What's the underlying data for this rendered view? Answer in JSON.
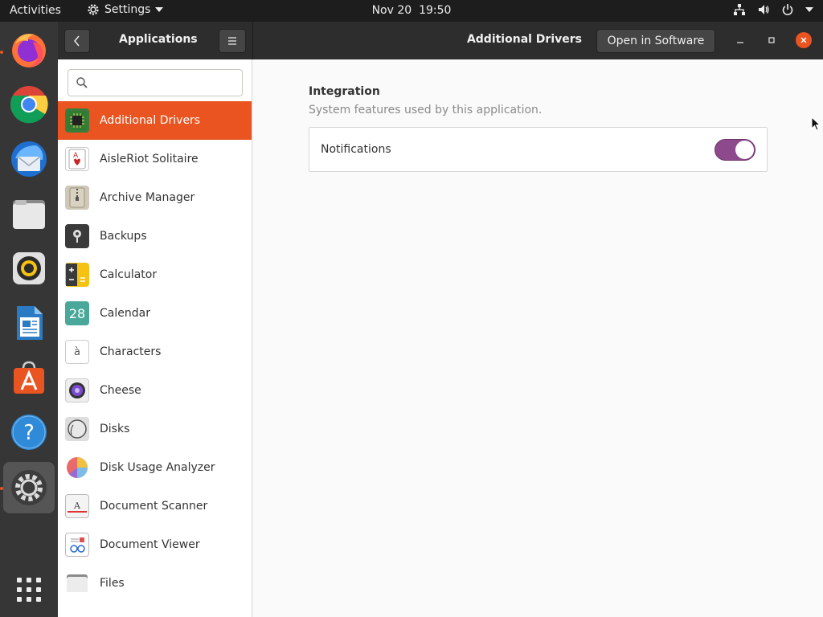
{
  "topbar": {
    "activities": "Activities",
    "app_menu": "Settings",
    "date": "Nov 20",
    "time": "19:50"
  },
  "dock": {
    "items": [
      {
        "name": "firefox",
        "running": true
      },
      {
        "name": "chrome",
        "running": false
      },
      {
        "name": "thunderbird",
        "running": false
      },
      {
        "name": "files",
        "running": false
      },
      {
        "name": "rhythmbox",
        "running": false
      },
      {
        "name": "libreoffice-writer",
        "running": false
      },
      {
        "name": "ubuntu-software",
        "running": false
      },
      {
        "name": "help",
        "running": false
      },
      {
        "name": "settings",
        "running": true,
        "active": true
      }
    ],
    "show_apps_icon": "grid-icon"
  },
  "headerbar": {
    "sidebar_title": "Applications",
    "panel_title": "Additional Drivers",
    "open_button": "Open in Software"
  },
  "sidebar": {
    "search_placeholder": "",
    "apps": [
      {
        "label": "Additional Drivers",
        "icon": "chip-icon",
        "selected": true
      },
      {
        "label": "AisleRiot Solitaire",
        "icon": "cards-icon"
      },
      {
        "label": "Archive Manager",
        "icon": "archive-icon"
      },
      {
        "label": "Backups",
        "icon": "safe-icon"
      },
      {
        "label": "Calculator",
        "icon": "calculator-icon"
      },
      {
        "label": "Calendar",
        "icon": "calendar-icon",
        "glyph": "28"
      },
      {
        "label": "Characters",
        "icon": "characters-icon",
        "glyph": "à"
      },
      {
        "label": "Cheese",
        "icon": "camera-icon"
      },
      {
        "label": "Disks",
        "icon": "disk-icon"
      },
      {
        "label": "Disk Usage Analyzer",
        "icon": "pie-icon"
      },
      {
        "label": "Document Scanner",
        "icon": "scanner-icon",
        "glyph": "A"
      },
      {
        "label": "Document Viewer",
        "icon": "document-viewer-icon"
      },
      {
        "label": "Files",
        "icon": "folder-icon"
      }
    ]
  },
  "main": {
    "section_title": "Integration",
    "section_subtitle": "System features used by this application.",
    "notifications_label": "Notifications",
    "notifications_enabled": true
  },
  "colors": {
    "accent": "#e95420",
    "toggle_on": "#8c4a8c"
  }
}
